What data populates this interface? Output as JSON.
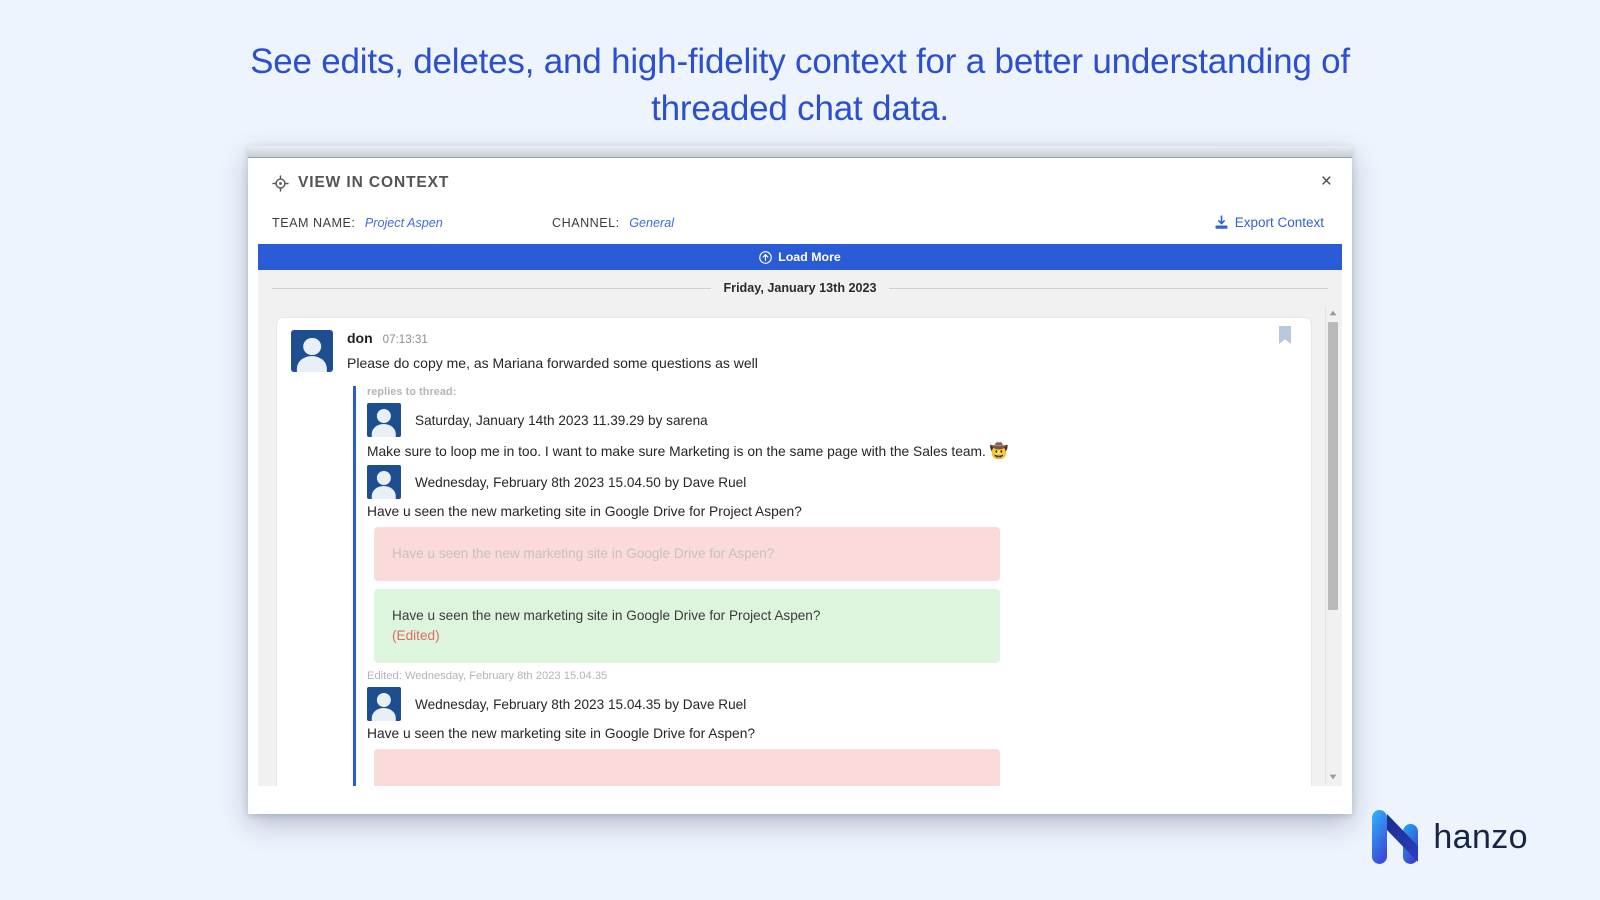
{
  "headline": "See edits, deletes, and high-fidelity context for a better understanding of threaded chat data.",
  "colors": {
    "page_bg": "#eef4fd",
    "headline": "#2b4fd0",
    "accent_blue": "#2a5bd7",
    "diff_delete_bg": "#fadbda",
    "diff_add_bg": "#ddf5dd",
    "edited_text": "#e06b66",
    "logo_dark": "#172347"
  },
  "modal": {
    "title": "VIEW IN CONTEXT",
    "title_icon": "crosshair-icon",
    "close_label": "×",
    "meta": {
      "team_label": "TEAM NAME:",
      "team_value": "Project Aspen",
      "channel_label": "CHANNEL:",
      "channel_value": "General"
    },
    "export": {
      "label": "Export Context",
      "icon": "download-icon"
    },
    "load_more": {
      "label": "Load More",
      "icon": "arrow-up-circle-icon"
    }
  },
  "thread": {
    "date_separator": "Friday, January 13th 2023",
    "bookmark_icon": "bookmark-icon",
    "root_message": {
      "author": "don",
      "time": "07:13:31",
      "text": "Please do copy me, as Mariana forwarded some questions as well",
      "avatar_icon": "user-avatar"
    },
    "replies_label": "replies to thread:",
    "replies": [
      {
        "meta": "Saturday, January 14th 2023 11.39.29 by sarena",
        "text": "Make sure to loop me in too. I want to make sure Marketing is on the same page with the Sales team.",
        "emoji": "🤠",
        "avatar_icon": "user-avatar"
      },
      {
        "meta": "Wednesday, February 8th 2023 15.04.50 by Dave Ruel",
        "text": "Have u seen the new marketing site in Google Drive for Project Aspen?",
        "avatar_icon": "user-avatar",
        "diff": {
          "deleted": "Have u seen the new marketing site in Google Drive for Aspen?",
          "added": "Have u seen the new marketing site in Google Drive for Project Aspen?",
          "added_tag": "(Edited)"
        },
        "edited_stamp": "Edited: Wednesday, February 8th 2023 15.04.35"
      },
      {
        "meta": "Wednesday, February 8th 2023 15.04.35 by Dave Ruel",
        "text": "Have u seen the new marketing site in Google Drive for Aspen?",
        "avatar_icon": "user-avatar",
        "diff": {
          "deleted": "",
          "added": "",
          "added_tag": ""
        }
      }
    ]
  },
  "brand": {
    "name": "hanzo",
    "mark": "hanzo-logo-icon"
  }
}
